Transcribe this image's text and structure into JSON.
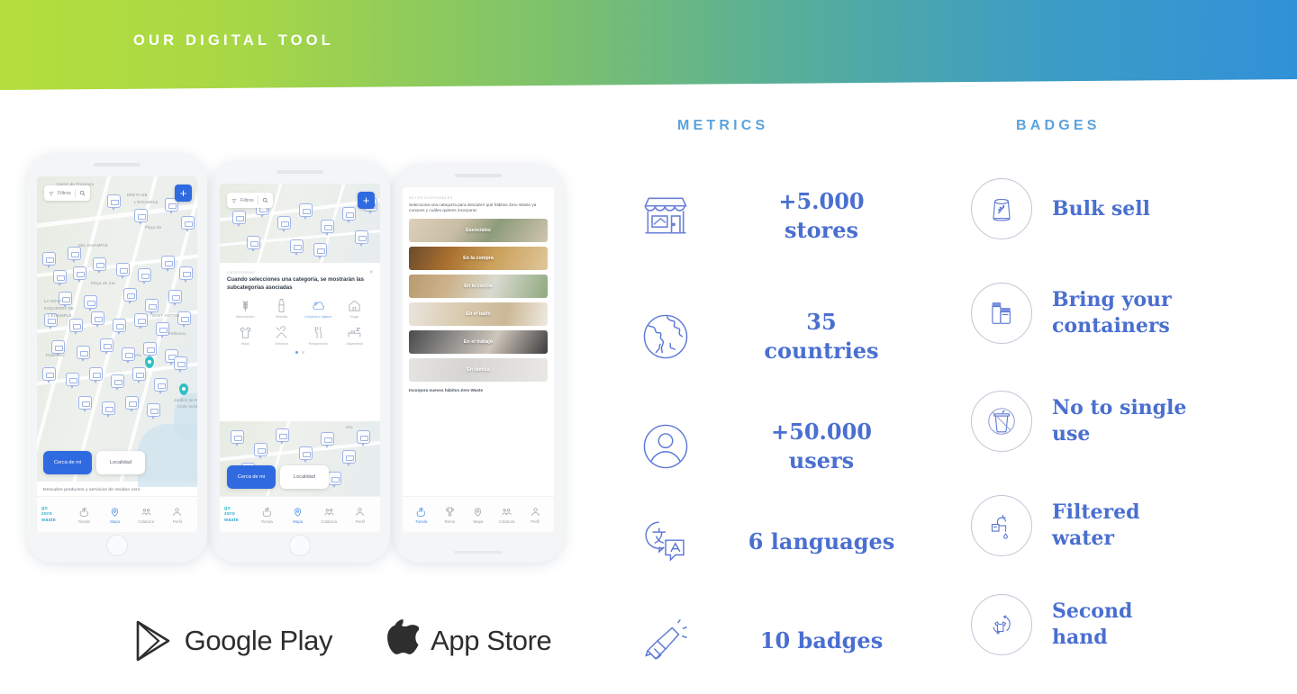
{
  "header": {
    "title": "OUR DIGITAL TOOL",
    "gradient_start": "#b5de3c",
    "gradient_end": "#3191d8"
  },
  "theme": {
    "accent_blue": "#4a6fd0",
    "heading_blue": "#5ba3dc",
    "app_blue": "#2f6ae0",
    "badge_ring": "#bfc6d4"
  },
  "metrics": {
    "heading": "METRICS",
    "items": [
      {
        "icon": "storefront-icon",
        "value": "+5.000\nstores"
      },
      {
        "icon": "globe-icon",
        "value": "35\ncountries"
      },
      {
        "icon": "user-icon",
        "value": "+50.000\nusers"
      },
      {
        "icon": "translate-icon",
        "value": "6 languages"
      },
      {
        "icon": "megaphone-icon",
        "value": "10 badges"
      }
    ]
  },
  "badges": {
    "heading": "BADGES",
    "items": [
      {
        "icon": "bulk-sack-icon",
        "label": "Bulk sell"
      },
      {
        "icon": "containers-icon",
        "label": "Bring your\ncontainers"
      },
      {
        "icon": "no-single-use-icon",
        "label": "No to single\nuse"
      },
      {
        "icon": "faucet-icon",
        "label": "Filtered\nwater"
      },
      {
        "icon": "second-hand-icon",
        "label": "Second\nhand"
      }
    ]
  },
  "store_badges": [
    {
      "icon": "google-play-icon",
      "label": "Google Play"
    },
    {
      "icon": "apple-icon",
      "label": "App Store"
    }
  ],
  "phones": {
    "phone1": {
      "search_placeholder": "Filtros",
      "add_button": "+",
      "toggle": {
        "active": "Cerca de mi",
        "inactive": "Localidad"
      },
      "tagline": "Descubre productos y servicios de residuo cero",
      "map_labels": [
        "Carrer de Provença",
        "DRETA DE L'EIXAMPLE",
        "Plaça de Catalunya",
        "LA NOVA ESQUERRA DE L'EIXAMPLE",
        "Plaça de Cat",
        "SANT ANTONI",
        "Poblenou",
        "Poble-sec",
        "Jardins de Mossèn Cinto Verdaguer"
      ],
      "nav": {
        "logo": "go\nzero\nwaste",
        "items": [
          {
            "icon": "hands-icon",
            "label": "Tienda",
            "selected": false
          },
          {
            "icon": "map-pin-icon",
            "label": "Mapa",
            "selected": true
          },
          {
            "icon": "collaborate-icon",
            "label": "Colabora",
            "selected": false
          },
          {
            "icon": "profile-icon",
            "label": "Perfil",
            "selected": false
          }
        ]
      }
    },
    "phone2": {
      "search_placeholder": "Filtros",
      "add_button": "+",
      "sheet_kicker": "CATEGORÍAS",
      "sheet_title": "Cuando selecciones una categoría, se mostrarán las subcategorías asociadas",
      "close": "×",
      "categories": [
        {
          "icon": "wheat-icon",
          "label": "Alimentación",
          "selected": false
        },
        {
          "icon": "bottle-icon",
          "label": "Bebidas",
          "selected": false
        },
        {
          "icon": "cleaning-icon",
          "label": "Limpieza e higiene",
          "selected": true
        },
        {
          "icon": "house-icon",
          "label": "Hogar",
          "selected": false
        },
        {
          "icon": "tshirt-icon",
          "label": "Ropa",
          "selected": false
        },
        {
          "icon": "tools-icon",
          "label": "Servicios",
          "selected": false
        },
        {
          "icon": "cutlery-icon",
          "label": "Restauración",
          "selected": false
        },
        {
          "icon": "bed-icon",
          "label": "Alojamiento",
          "selected": false
        }
      ],
      "pagination": {
        "pages": 2,
        "current": 1
      },
      "toggle": {
        "active": "Cerca de mi",
        "inactive": "Localidad"
      }
    },
    "phone3": {
      "kicker": "RETOS DISPONIBLES",
      "intro": "Selecciona una categoría para descubrir qué hábitos Zero Waste ya conoces y cuáles quieres incorporar.",
      "cards": [
        "Esenciales",
        "En la compra",
        "En la cocina",
        "En el baño",
        "En el trabajo",
        "En familia"
      ],
      "footer": "Incorpora nuevos hábitos Zero Waste",
      "nav": {
        "items": [
          {
            "label": "Tienda",
            "selected": true
          },
          {
            "label": "Retos",
            "selected": false
          },
          {
            "label": "Mapa",
            "selected": false
          },
          {
            "label": "Colabora",
            "selected": false
          },
          {
            "label": "Perfil",
            "selected": false
          }
        ]
      }
    }
  }
}
